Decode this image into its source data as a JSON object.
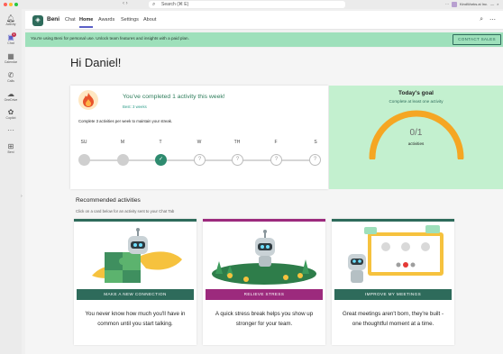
{
  "titlebar": {
    "nav_arrows": "‹ ›",
    "search_placeholder": "Search (⌘ E)",
    "org_name": "KindWorks.ai Inc.",
    "more": "···",
    "minimize": "—",
    "close": "×"
  },
  "rail": {
    "items": [
      {
        "label": "Activity",
        "icon": "bell-icon"
      },
      {
        "label": "Chat",
        "icon": "chat-icon",
        "badge": "1"
      },
      {
        "label": "Calendar",
        "icon": "calendar-icon"
      },
      {
        "label": "Calls",
        "icon": "phone-icon"
      },
      {
        "label": "OneDrive",
        "icon": "cloud-icon"
      },
      {
        "label": "Copilot",
        "icon": "copilot-icon"
      },
      {
        "label": "···",
        "icon": "more-icon"
      },
      {
        "label": "Beni",
        "icon": "beni-app-icon"
      }
    ]
  },
  "appbar": {
    "app_name": "Beni",
    "tabs": [
      "Chat",
      "Home",
      "Awards",
      "Settings",
      "About"
    ],
    "active_tab": "Home"
  },
  "banner": {
    "text": "You're using Beni for personal use. Unlock team features and insights with a paid plan.",
    "button": "CONTACT SALES"
  },
  "greeting": "Hi Daniel!",
  "streak": {
    "title": "You've completed 1 activity this week!",
    "best": "Best: 3 weeks",
    "note": "Complete 3 activities per week to maintain your streak.",
    "days": [
      {
        "label": "SU",
        "state": "past",
        "symbol": ""
      },
      {
        "label": "M",
        "state": "past",
        "symbol": ""
      },
      {
        "label": "T",
        "state": "done",
        "symbol": "✓"
      },
      {
        "label": "W",
        "state": "future",
        "symbol": "?"
      },
      {
        "label": "TH",
        "state": "future",
        "symbol": "?"
      },
      {
        "label": "F",
        "state": "future",
        "symbol": "?"
      },
      {
        "label": "S",
        "state": "future",
        "symbol": "?"
      }
    ]
  },
  "goal": {
    "title": "Today's goal",
    "subtitle": "Complete at least one activity",
    "count": "0/1",
    "unit": "activities",
    "progress": 0
  },
  "recommended": {
    "title": "Recommended activities",
    "subtitle": "Click on a card below for an activity sent to your Chat Tab",
    "cards": [
      {
        "button": "MAKE A NEW CONNECTION",
        "description": "You never know how much you'll have in common until you start talking.",
        "accent": "#2e6b5b"
      },
      {
        "button": "RELIEVE STRESS",
        "description": "A quick stress break helps you show up stronger for your team.",
        "accent": "#9c2a7d"
      },
      {
        "button": "IMPROVE MY MEETINGS",
        "description": "Great meetings aren't born, they're built - one thoughtful moment at a time.",
        "accent": "#2e6b5b"
      }
    ]
  },
  "colors": {
    "brand": "#2e6b5b",
    "banner": "#9ee0bb",
    "goal_bg": "#c3f0cf",
    "ring": "#f5a623",
    "stress": "#9c2a7d"
  }
}
